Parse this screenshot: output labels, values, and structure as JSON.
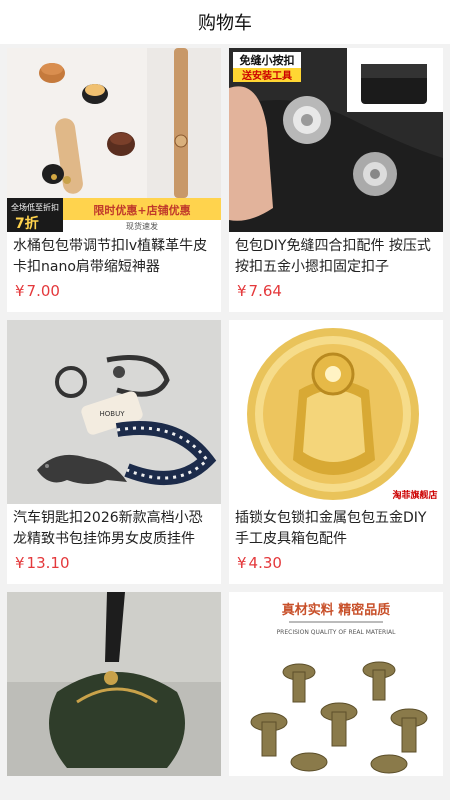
{
  "header": {
    "title": "购物车"
  },
  "currency": "¥",
  "products": [
    {
      "name": "水桶包包带调节扣lv植鞣革牛皮卡扣nano肩带缩短神器",
      "price": "7.00",
      "badge": {
        "brand": "全场低至折扣",
        "discount": "7折",
        "promo": "限时优惠+店铺优惠",
        "ship": "现货速发"
      }
    },
    {
      "name": "包包DIY免缝四合扣配件 按压式按扣五金小摁扣固定扣子",
      "price": "7.64",
      "badge": {
        "title": "免缝小按扣",
        "sub": "送安装工具"
      }
    },
    {
      "name": "汽车钥匙扣2026新款高档小恐龙精致书包挂饰男女皮质挂件",
      "price": "13.10",
      "badge": {
        "tag": "HOBUY"
      }
    },
    {
      "name": "插锁女包锁扣金属包包五金DIY手工皮具箱包配件",
      "price": "4.30",
      "badge": {
        "shop": "淘菲旗舰店"
      }
    },
    {
      "name": "",
      "price": "",
      "badge": {}
    },
    {
      "name": "",
      "price": "",
      "badge": {
        "title": "真材实料 精密品质",
        "sub": "PRECISION QUALITY OF REAL MATERIAL"
      }
    }
  ]
}
